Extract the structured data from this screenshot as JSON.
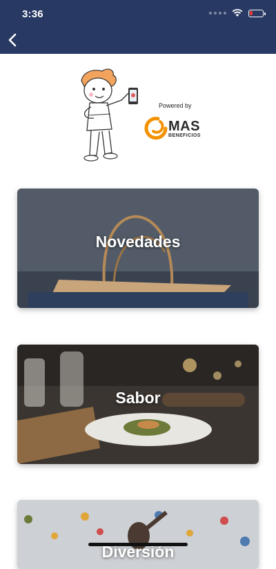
{
  "status_bar": {
    "time": "3:36"
  },
  "header": {
    "back_icon": "chevron-left-icon",
    "background": "#283a63"
  },
  "branding": {
    "powered_by": "Powered by",
    "brand_name": "MAS",
    "brand_sub": "BENEFICIOS",
    "accent_color": "#f39200"
  },
  "categories": [
    {
      "label": "Novedades"
    },
    {
      "label": "Sabor"
    },
    {
      "label": "Diversión"
    }
  ]
}
